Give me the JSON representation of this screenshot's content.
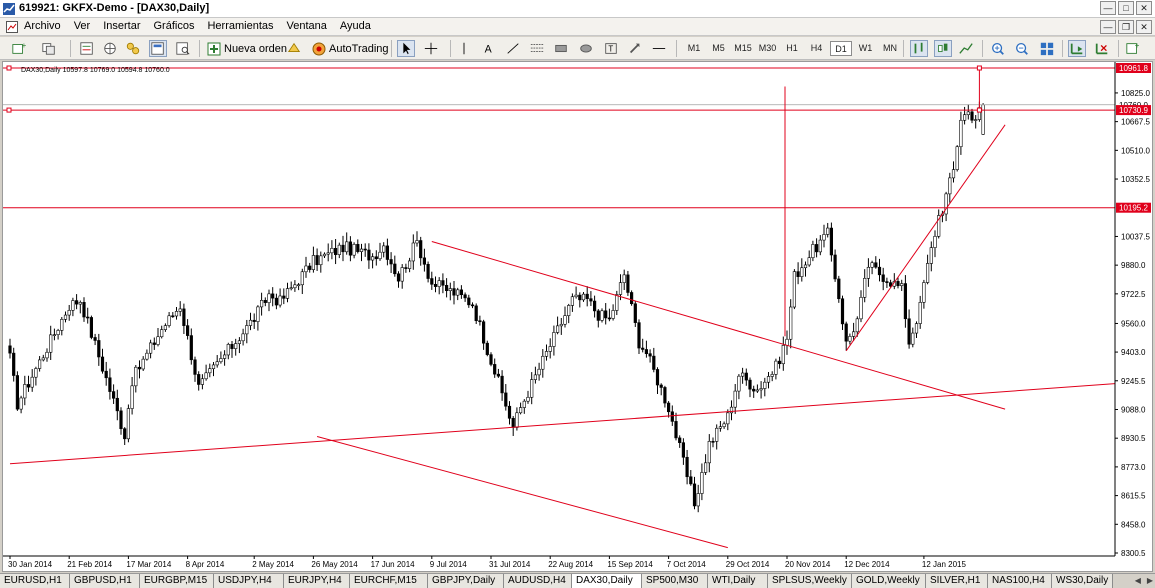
{
  "window": {
    "title": "619921: GKFX-Demo - [DAX30,Daily]"
  },
  "menu": {
    "items": [
      "Archivo",
      "Ver",
      "Insertar",
      "Gráficos",
      "Herramientas",
      "Ventana",
      "Ayuda"
    ]
  },
  "toolbar": {
    "new_order_label": "Nueva orden",
    "autotrading_label": "AutoTrading",
    "timeframes": [
      "M1",
      "M5",
      "M15",
      "M30",
      "H1",
      "H4",
      "D1",
      "W1",
      "MN"
    ],
    "active_timeframe": "D1"
  },
  "chart": {
    "info_label": "DAX30,Daily  10597.8 10769.0 10594.8 10760.0",
    "price_labels": [
      "10825.0",
      "10667.5",
      "10510.0",
      "10352.5",
      "10037.5",
      "9880.0",
      "9722.5",
      "9560.0",
      "9403.0",
      "9245.5",
      "9088.0",
      "8930.5",
      "8773.0",
      "8615.5",
      "8458.0",
      "8300.5"
    ],
    "hline_tags": [
      "10961.8",
      "10760.0",
      "10730.9",
      "10195.2"
    ],
    "date_labels": [
      "30 Jan 2014",
      "21 Feb 2014",
      "17 Mar 2014",
      "8 Apr 2014",
      "2 May 2014",
      "26 May 2014",
      "17 Jun 2014",
      "9 Jul 2014",
      "31 Jul 2014",
      "22 Aug 2014",
      "15 Sep 2014",
      "7 Oct 2014",
      "29 Oct 2014",
      "20 Nov 2014",
      "12 Dec 2014",
      "12 Jan 2015"
    ],
    "colors": {
      "line": "#e0001b",
      "candle": "#000000",
      "background": "#ffffff"
    }
  },
  "chart_data": {
    "type": "candlestick",
    "symbol": "DAX30",
    "timeframe": "Daily",
    "last_bar": {
      "open": 10597.8,
      "high": 10769.0,
      "low": 10594.8,
      "close": 10760.0
    },
    "ylim": [
      8300.5,
      10961.8
    ],
    "x_ticks": [
      "30 Jan 2014",
      "21 Feb 2014",
      "17 Mar 2014",
      "8 Apr 2014",
      "2 May 2014",
      "26 May 2014",
      "17 Jun 2014",
      "9 Jul 2014",
      "31 Jul 2014",
      "22 Aug 2014",
      "15 Sep 2014",
      "7 Oct 2014",
      "29 Oct 2014",
      "20 Nov 2014",
      "12 Dec 2014",
      "12 Jan 2015"
    ],
    "y_ticks": [
      10825.0,
      10667.5,
      10510.0,
      10352.5,
      10037.5,
      9880.0,
      9722.5,
      9560.0,
      9403.0,
      9245.5,
      9088.0,
      8930.5,
      8773.0,
      8615.5,
      8458.0,
      8300.5
    ],
    "horizontal_lines": [
      10961.8,
      10730.9,
      10195.2
    ],
    "trend_lines": [
      {
        "from": [
          "30 Jan 2014",
          8790
        ],
        "to": [
          "chart end",
          9230
        ]
      },
      {
        "from": [
          "9 Jul 2014",
          10010
        ],
        "to": [
          "Feb 2015",
          9090
        ]
      },
      {
        "from": [
          "27 May 2014",
          8940
        ],
        "to": [
          "29 Oct 2014",
          8330
        ]
      },
      {
        "from": [
          "12 Dec 2014",
          9410
        ],
        "to": [
          "Feb 2015",
          10650
        ]
      }
    ],
    "path_keypoints": [
      [
        "30 Jan 2014",
        9370
      ],
      [
        "3 Feb 2014",
        9120
      ],
      [
        "21 Feb 2014",
        9660
      ],
      [
        "26 Feb 2014",
        9690
      ],
      [
        "14 Mar 2014",
        8950
      ],
      [
        "18 Mar 2014",
        9250
      ],
      [
        "28 Mar 2014",
        9530
      ],
      [
        "4 Apr 2014",
        9660
      ],
      [
        "11 Apr 2014",
        9210
      ],
      [
        "15 Apr 2014",
        9260
      ],
      [
        "2 May 2014",
        9590
      ],
      [
        "8 May 2014",
        9720
      ],
      [
        "13 May 2014",
        9680
      ],
      [
        "26 May 2014",
        9900
      ],
      [
        "5 Jun 2014",
        9980
      ],
      [
        "17 Jun 2014",
        9930
      ],
      [
        "20 Jun 2014",
        9990
      ],
      [
        "26 Jun 2014",
        9810
      ],
      [
        "3 Jul 2014",
        10010
      ],
      [
        "9 Jul 2014",
        9780
      ],
      [
        "17 Jul 2014",
        9730
      ],
      [
        "24 Jul 2014",
        9670
      ],
      [
        "8 Aug 2014",
        8990
      ],
      [
        "12 Aug 2014",
        9100
      ],
      [
        "22 Aug 2014",
        9440
      ],
      [
        "1 Sep 2014",
        9690
      ],
      [
        "5 Sep 2014",
        9690
      ],
      [
        "10 Sep 2014",
        9610
      ],
      [
        "15 Sep 2014",
        9580
      ],
      [
        "19 Sep 2014",
        9830
      ],
      [
        "25 Sep 2014",
        9460
      ],
      [
        "29 Sep 2014",
        9400
      ],
      [
        "7 Oct 2014",
        9100
      ],
      [
        "16 Oct 2014",
        8570
      ],
      [
        "22 Oct 2014",
        8900
      ],
      [
        "29 Oct 2014",
        9050
      ],
      [
        "3 Nov 2014",
        9280
      ],
      [
        "10 Nov 2014",
        9200
      ],
      [
        "17 Nov 2014",
        9320
      ],
      [
        "20 Nov 2014",
        9480
      ],
      [
        "24 Nov 2014",
        9820
      ],
      [
        "1 Dec 2014",
        9960
      ],
      [
        "5 Dec 2014",
        10050
      ],
      [
        "10 Dec 2014",
        9710
      ],
      [
        "12 Dec 2014",
        9450
      ],
      [
        "17 Dec 2014",
        9580
      ],
      [
        "22 Dec 2014",
        9880
      ],
      [
        "2 Jan 2015",
        9750
      ],
      [
        "6 Jan 2015",
        9460
      ],
      [
        "9 Jan 2015",
        9650
      ],
      [
        "12 Jan 2015",
        9780
      ],
      [
        "16 Jan 2015",
        10150
      ],
      [
        "19 Jan 2015",
        10190
      ],
      [
        "22 Jan 2015",
        10400
      ],
      [
        "26 Jan 2015",
        10690
      ],
      [
        "28 Jan 2015",
        10720
      ],
      [
        "30 Jan 2015",
        10690
      ],
      [
        "3 Feb 2015",
        10760
      ]
    ]
  },
  "tabs": {
    "items": [
      "EURUSD,H1",
      "GBPUSD,H1",
      "EURGBP,M15",
      "USDJPY,H4",
      "EURJPY,H4",
      "EURCHF,M15",
      "GBPJPY,Daily",
      "AUDUSD,H4",
      "DAX30,Daily",
      "SP500,M30",
      "WTI,Daily",
      "SPLSUS,Weekly",
      "GOLD,Weekly",
      "SILVER,H1",
      "NAS100,H4",
      "WS30,Daily"
    ],
    "active": "DAX30,Daily"
  }
}
